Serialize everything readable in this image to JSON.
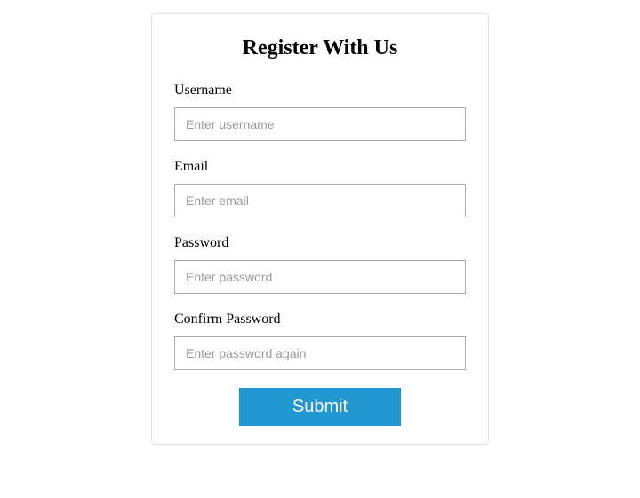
{
  "form": {
    "title": "Register With Us",
    "fields": {
      "username": {
        "label": "Username",
        "placeholder": "Enter username",
        "value": ""
      },
      "email": {
        "label": "Email",
        "placeholder": "Enter email",
        "value": ""
      },
      "password": {
        "label": "Password",
        "placeholder": "Enter password",
        "value": ""
      },
      "confirm_password": {
        "label": "Confirm Password",
        "placeholder": "Enter password again",
        "value": ""
      }
    },
    "submit_label": "Submit"
  }
}
